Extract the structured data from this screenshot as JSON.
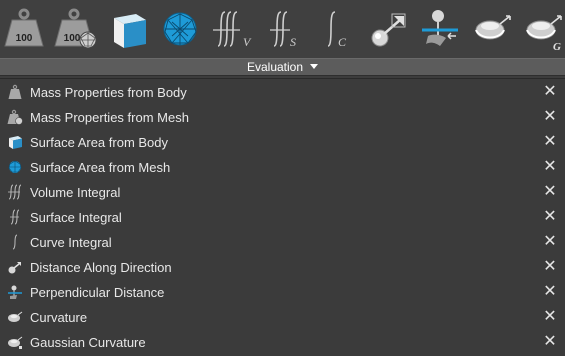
{
  "toolbar": {
    "icons": [
      {
        "name": "mass-properties-from-body-icon",
        "text": "100"
      },
      {
        "name": "mass-properties-from-mesh-icon",
        "text": "100"
      },
      {
        "name": "surface-area-from-body-icon"
      },
      {
        "name": "surface-area-from-mesh-icon"
      },
      {
        "name": "volume-integral-icon",
        "subscript": "V"
      },
      {
        "name": "surface-integral-icon",
        "subscript": "S"
      },
      {
        "name": "curve-integral-icon",
        "subscript": "C"
      },
      {
        "name": "distance-along-direction-icon"
      },
      {
        "name": "perpendicular-distance-icon"
      },
      {
        "name": "curvature-icon"
      },
      {
        "name": "gaussian-curvature-icon",
        "subscript": "G"
      }
    ]
  },
  "section": {
    "title": "Evaluation"
  },
  "list": {
    "items": [
      {
        "label": "Mass Properties from Body",
        "icon": "weight-icon"
      },
      {
        "label": "Mass Properties from Mesh",
        "icon": "weight-mesh-icon"
      },
      {
        "label": "Surface Area from Body",
        "icon": "cube-icon"
      },
      {
        "label": "Surface Area from Mesh",
        "icon": "mesh-sphere-icon"
      },
      {
        "label": "Volume Integral",
        "icon": "triple-integral-icon"
      },
      {
        "label": "Surface Integral",
        "icon": "double-integral-icon"
      },
      {
        "label": "Curve Integral",
        "icon": "integral-icon"
      },
      {
        "label": "Distance Along Direction",
        "icon": "direction-arrow-icon"
      },
      {
        "label": "Perpendicular Distance",
        "icon": "perpendicular-icon"
      },
      {
        "label": "Curvature",
        "icon": "curvature-icon"
      },
      {
        "label": "Gaussian Curvature",
        "icon": "gaussian-curvature-icon"
      }
    ],
    "close_glyph": "✕"
  },
  "colors": {
    "accent": "#1e9bd7",
    "panel": "#3b3b3b",
    "header": "#5c5c5c"
  }
}
